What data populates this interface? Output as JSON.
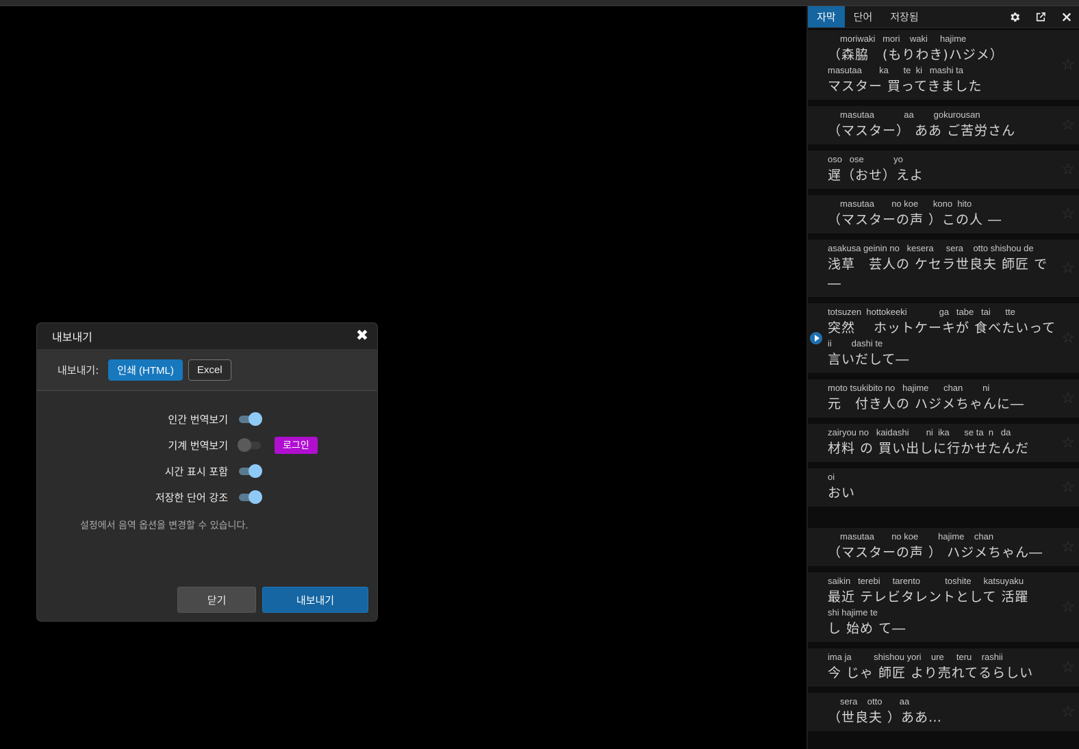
{
  "panel": {
    "tabs": [
      "자막",
      "단어",
      "저장됨"
    ],
    "active_tab": 0,
    "tools": [
      "gear-icon",
      "export-icon",
      "close-icon"
    ]
  },
  "subtitles": [
    {
      "lines": [
        {
          "rom": "     moriwaki   mori    waki     hajime",
          "jp": "（森脇　(もりわき)ハジメ）"
        },
        {
          "rom": "masutaa       ka      te  ki   mashi ta",
          "jp": "マスター 買ってきました"
        }
      ]
    },
    {
      "lines": [
        {
          "rom": "     masutaa            aa        gokurousan",
          "jp": "（マスター） ああ ご苦労さん"
        }
      ]
    },
    {
      "lines": [
        {
          "rom": "oso   ose            yo",
          "jp": "遅（おせ）えよ"
        }
      ]
    },
    {
      "lines": [
        {
          "rom": "     masutaa       no koe      kono  hito",
          "jp": "（マスターの声 ）この人 ―"
        }
      ]
    },
    {
      "lines": [
        {
          "rom": "asakusa geinin no   kesera     sera    otto shishou de",
          "jp": "浅草　芸人の ケセラ世良夫 師匠 で\n―"
        }
      ]
    },
    {
      "playing": true,
      "lines": [
        {
          "rom": "totsuzen  hottokeeki             ga   tabe   tai      tte",
          "jp": "突然　 ホットケーキが 食べたいって"
        },
        {
          "rom": "ii        dashi te",
          "jp": "言いだして―"
        }
      ]
    },
    {
      "lines": [
        {
          "rom": "moto tsukibito no   hajime      chan        ni",
          "jp": "元　付き人の ハジメちゃんに―"
        }
      ]
    },
    {
      "lines": [
        {
          "rom": "zairyou no   kaidashi       ni  ika      se ta  n   da",
          "jp": "材料 の 買い出しに行かせたんだ"
        }
      ]
    },
    {
      "gap_after": true,
      "lines": [
        {
          "rom": "oi",
          "jp": "おい"
        }
      ]
    },
    {
      "lines": [
        {
          "rom": "     masutaa       no koe        hajime    chan",
          "jp": "（マスターの声 ） ハジメちゃん―"
        }
      ]
    },
    {
      "lines": [
        {
          "rom": "saikin   terebi     tarento          toshite     katsuyaku",
          "jp": "最近 テレビタレントとして 活躍"
        },
        {
          "rom": "shi hajime te",
          "jp": "し 始め て―"
        }
      ]
    },
    {
      "lines": [
        {
          "rom": "ima ja         shishou yori    ure     teru    rashii",
          "jp": "今 じゃ 師匠 より売れてるらしい"
        }
      ]
    },
    {
      "lines": [
        {
          "rom": "     sera    otto       aa",
          "jp": "（世良夫 ）ああ…"
        }
      ]
    }
  ],
  "dialog": {
    "title": "내보내기",
    "export_label": "내보내기:",
    "format_html": "인쇄 (HTML)",
    "format_excel": "Excel",
    "options": [
      {
        "label": "인간 번역보기",
        "on": true
      },
      {
        "label": "기계 번역보기",
        "on": false,
        "extra": "로그인"
      },
      {
        "label": "시간 표시 포함",
        "on": true
      },
      {
        "label": "저장한 단어 강조",
        "on": true
      }
    ],
    "note": "설정에서 음역 옵션을 변경할 수 있습니다.",
    "cancel": "닫기",
    "confirm": "내보내기"
  },
  "colors": {
    "accent": "#1878bd",
    "login": "#b00fd0",
    "toggle_on": "#8fcaf7"
  }
}
